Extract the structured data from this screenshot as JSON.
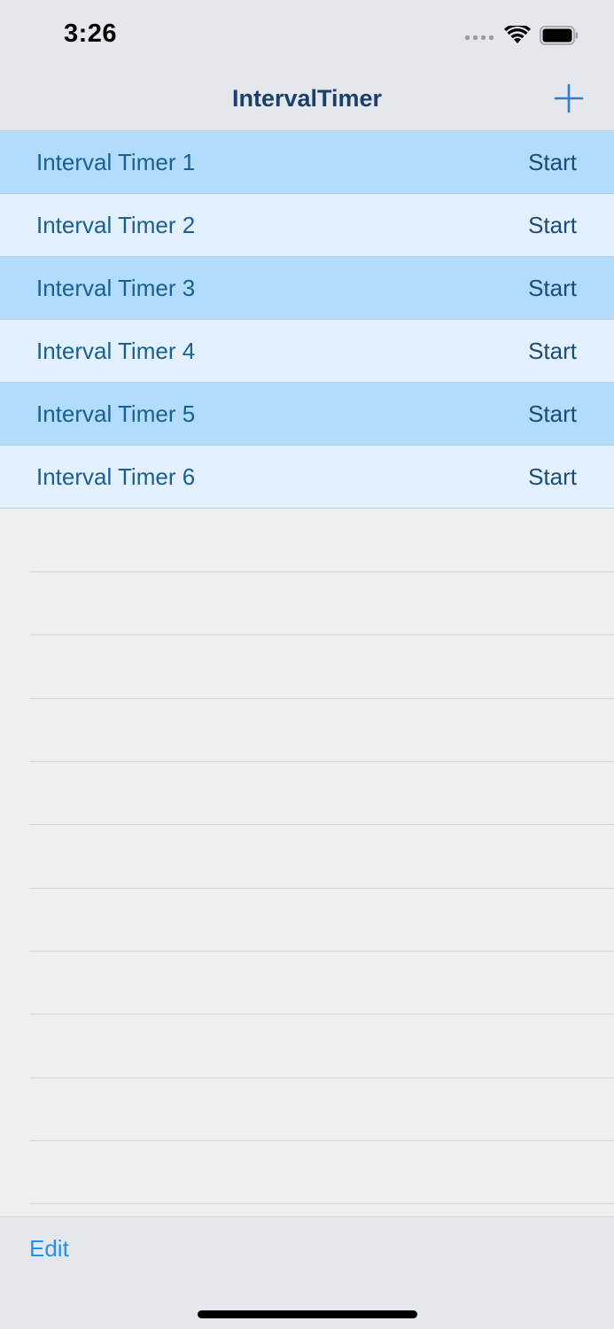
{
  "status_bar": {
    "time": "3:26",
    "icons": [
      "signal-dots-icon",
      "wifi-icon",
      "battery-icon"
    ]
  },
  "nav": {
    "title": "IntervalTimer",
    "add_icon": "plus-icon"
  },
  "timers": [
    {
      "name": "Interval Timer 1",
      "action": "Start"
    },
    {
      "name": "Interval Timer 2",
      "action": "Start"
    },
    {
      "name": "Interval Timer 3",
      "action": "Start"
    },
    {
      "name": "Interval Timer 4",
      "action": "Start"
    },
    {
      "name": "Interval Timer 5",
      "action": "Start"
    },
    {
      "name": "Interval Timer 6",
      "action": "Start"
    }
  ],
  "toolbar": {
    "edit_label": "Edit"
  },
  "colors": {
    "row_alt_dark": "#b2dcfd",
    "row_alt_light": "#e3f1fe",
    "accent": "#2a8fe6",
    "title": "#1a3f6b"
  }
}
